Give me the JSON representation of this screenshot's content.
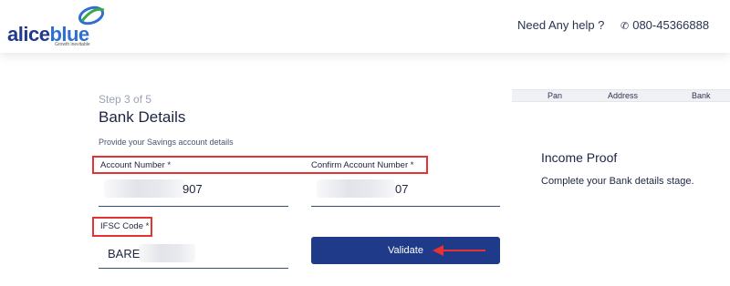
{
  "header": {
    "logo": {
      "part1": "alice",
      "part2": "blue",
      "tagline": "Growth inevitable"
    },
    "help_text": "Need Any help ?",
    "phone": "080-45366888",
    "phone_icon": "phone-icon"
  },
  "form": {
    "step": "Step 3 of 5",
    "title": "Bank Details",
    "subtitle": "Provide your Savings account details",
    "account_number": {
      "label": "Account Number *",
      "visible_value": "907"
    },
    "confirm_account_number": {
      "label": "Confirm Account Number *",
      "visible_value": "07"
    },
    "ifsc": {
      "label": "IFSC Code *",
      "visible_value": "BARE"
    },
    "validate_label": "Validate"
  },
  "progress_tabs": [
    "Pan",
    "Address",
    "Bank"
  ],
  "side_panel": {
    "title": "Income Proof",
    "description": "Complete your Bank details stage."
  },
  "colors": {
    "brand_dark": "#233a8a",
    "brand_light": "#2f6fd0",
    "button": "#1f3a88",
    "highlight": "#e53232"
  }
}
